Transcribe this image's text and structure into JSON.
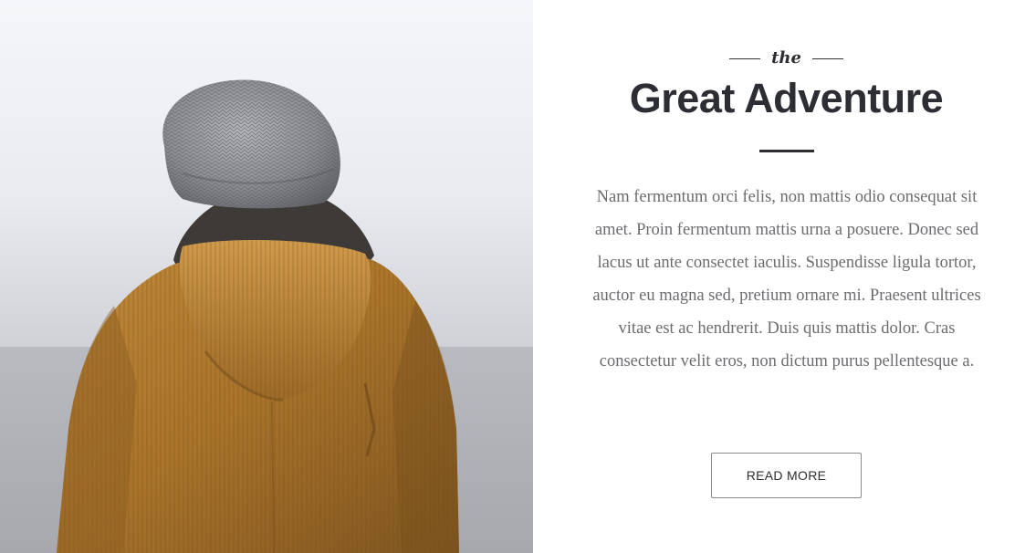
{
  "hero": {
    "image_description_icon": "person-in-beanie-and-hooded-jacket-photo"
  },
  "article": {
    "eyebrow": "the",
    "title": "Great Adventure",
    "body": "Nam fermentum orci felis, non mattis odio consequat sit amet. Proin fermentum mattis urna a posuere. Donec sed lacus ut ante consectet iaculis. Suspendisse ligula tortor, auctor eu magna sed, pretium ornare mi. Praesent ultrices vitae est ac hendrerit. Duis quis mattis dolor. Cras consectetur velit eros, non dictum purus pellentesque a.",
    "button_label": "READ MORE"
  },
  "colors": {
    "heading": "#2d2e33",
    "body_text": "#6b6c70",
    "jacket": "#b07a2e",
    "beanie": "#8f9196"
  }
}
